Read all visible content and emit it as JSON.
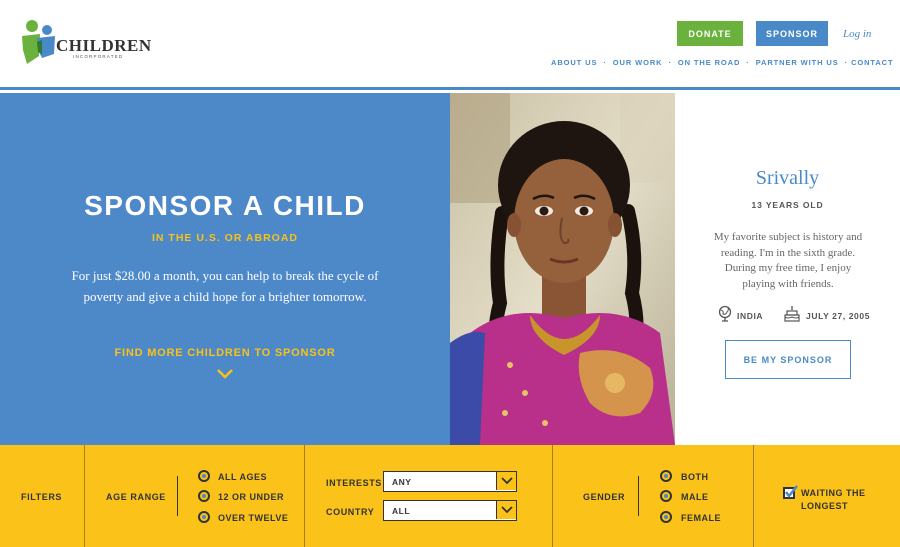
{
  "header": {
    "logo_word": "CHILDREN",
    "logo_sub": "INCORPORATED",
    "donate_label": "DONATE",
    "sponsor_label": "SPONSOR",
    "login_label": "Log in",
    "nav": [
      "ABOUT US",
      "OUR WORK",
      "ON THE ROAD",
      "PARTNER WITH US",
      "CONTACT"
    ]
  },
  "hero": {
    "title": "SPONSOR A CHILD",
    "subtitle": "IN THE U.S. OR ABROAD",
    "text": "For just $28.00 a month, you can help to break the cycle of poverty and give a child hope for a brighter tomorrow.",
    "find_more": "FIND MORE CHILDREN TO SPONSOR"
  },
  "child": {
    "name": "Srivally",
    "age": "13 YEARS OLD",
    "bio": "My favorite subject is history and reading. I'm in the sixth grade. During my free time, I enjoy playing with friends.",
    "country": "INDIA",
    "birthday": "JULY 27, 2005",
    "button": "BE MY SPONSOR"
  },
  "filters": {
    "label": "FILTERS",
    "age_range_label": "AGE RANGE",
    "age_options": [
      "ALL AGES",
      "12 OR UNDER",
      "OVER TWELVE"
    ],
    "interests_label": "INTERESTS",
    "interests_value": "ANY",
    "country_label": "COUNTRY",
    "country_value": "ALL",
    "gender_label": "GENDER",
    "gender_options": [
      "BOTH",
      "MALE",
      "FEMALE"
    ],
    "waiting_label_1": "WAITING THE",
    "waiting_label_2": "LONGEST"
  },
  "colors": {
    "blue": "#4a89c8",
    "green": "#6ab23d",
    "yellow": "#fbc21a"
  }
}
